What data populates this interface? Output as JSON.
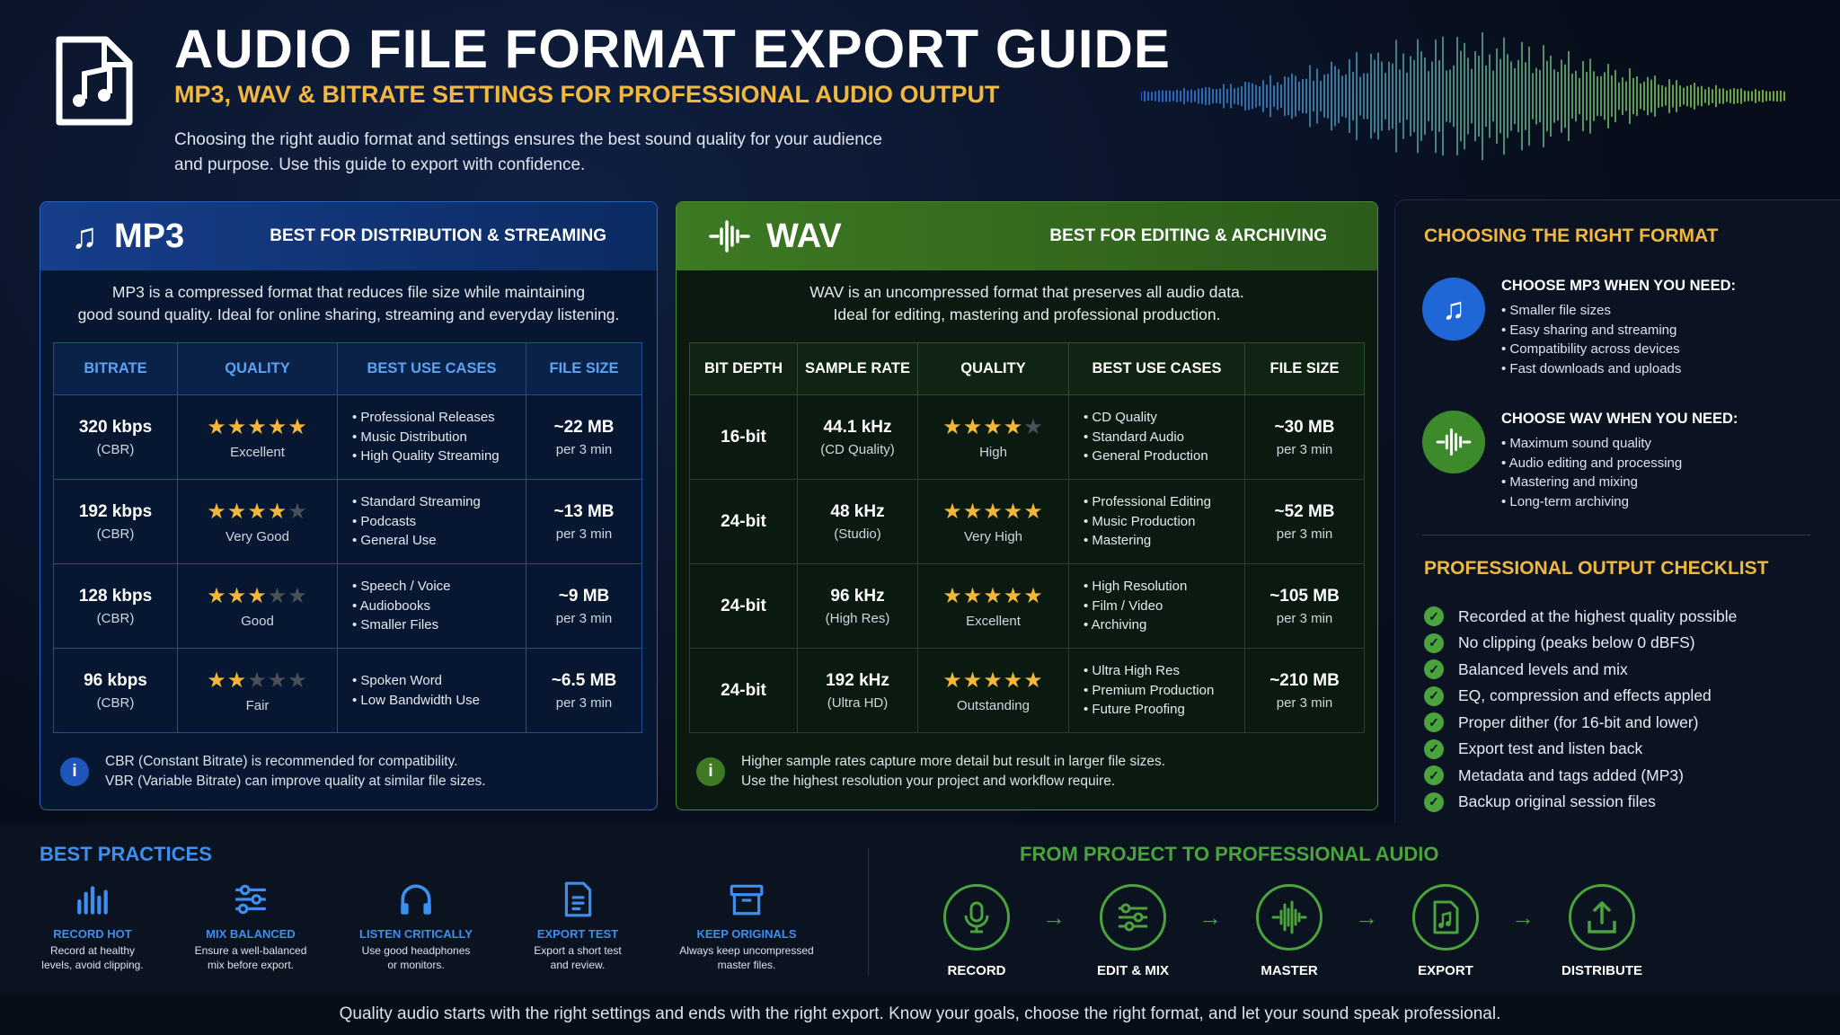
{
  "header": {
    "title": "AUDIO FILE FORMAT EXPORT GUIDE",
    "subtitle": "MP3, WAV & BITRATE SETTINGS FOR PROFESSIONAL AUDIO OUTPUT",
    "intro_line1": "Choosing the right audio format and settings ensures the best sound quality for your audience",
    "intro_line2": "and purpose. Use this guide to export with confidence."
  },
  "mp3": {
    "name": "MP3",
    "tag": "BEST FOR DISTRIBUTION & STREAMING",
    "desc_line1": "MP3 is a compressed format that reduces file size while maintaining",
    "desc_line2": "good sound quality. Ideal for online sharing, streaming and everyday listening.",
    "columns": [
      "BITRATE",
      "QUALITY",
      "BEST USE CASES",
      "FILE SIZE"
    ],
    "rows": [
      {
        "bitrate": "320 kbps",
        "mode": "(CBR)",
        "stars": 5,
        "quality": "Excellent",
        "uses": [
          "Professional Releases",
          "Music Distribution",
          "High Quality Streaming"
        ],
        "size": "~22 MB",
        "per": "per 3 min"
      },
      {
        "bitrate": "192 kbps",
        "mode": "(CBR)",
        "stars": 4,
        "quality": "Very Good",
        "uses": [
          "Standard Streaming",
          "Podcasts",
          "General Use"
        ],
        "size": "~13 MB",
        "per": "per 3 min"
      },
      {
        "bitrate": "128 kbps",
        "mode": "(CBR)",
        "stars": 3,
        "quality": "Good",
        "uses": [
          "Speech / Voice",
          "Audiobooks",
          "Smaller Files"
        ],
        "size": "~9 MB",
        "per": "per 3 min"
      },
      {
        "bitrate": "96 kbps",
        "mode": "(CBR)",
        "stars": 2,
        "quality": "Fair",
        "uses": [
          "Spoken Word",
          "Low Bandwidth Use"
        ],
        "size": "~6.5 MB",
        "per": "per 3 min"
      }
    ],
    "note_line1": "CBR (Constant Bitrate) is recommended for compatibility.",
    "note_line2": "VBR (Variable Bitrate) can improve quality at similar file sizes."
  },
  "wav": {
    "name": "WAV",
    "tag": "BEST FOR EDITING & ARCHIVING",
    "desc_line1": "WAV is an uncompressed format that preserves all audio data.",
    "desc_line2": "Ideal for editing, mastering and professional production.",
    "columns": [
      "BIT DEPTH",
      "SAMPLE RATE",
      "QUALITY",
      "BEST USE CASES",
      "FILE SIZE"
    ],
    "rows": [
      {
        "depth": "16-bit",
        "rate": "44.1 kHz",
        "rate_note": "(CD Quality)",
        "stars": 4,
        "quality": "High",
        "uses": [
          "CD Quality",
          "Standard Audio",
          "General Production"
        ],
        "size": "~30 MB",
        "per": "per 3 min"
      },
      {
        "depth": "24-bit",
        "rate": "48 kHz",
        "rate_note": "(Studio)",
        "stars": 5,
        "quality": "Very High",
        "uses": [
          "Professional Editing",
          "Music Production",
          "Mastering"
        ],
        "size": "~52 MB",
        "per": "per 3 min"
      },
      {
        "depth": "24-bit",
        "rate": "96 kHz",
        "rate_note": "(High Res)",
        "stars": 5,
        "quality": "Excellent",
        "uses": [
          "High Resolution",
          "Film / Video",
          "Archiving"
        ],
        "size": "~105 MB",
        "per": "per 3 min"
      },
      {
        "depth": "24-bit",
        "rate": "192 kHz",
        "rate_note": "(Ultra HD)",
        "stars": 5,
        "quality": "Outstanding",
        "uses": [
          "Ultra High Res",
          "Premium Production",
          "Future Proofing"
        ],
        "size": "~210 MB",
        "per": "per 3 min"
      }
    ],
    "note_line1": "Higher sample rates capture more detail but result in larger file sizes.",
    "note_line2": "Use the highest resolution your project and workflow require."
  },
  "choosing": {
    "title": "CHOOSING THE RIGHT FORMAT",
    "mp3_title": "CHOOSE MP3 WHEN YOU NEED:",
    "mp3_items": [
      "Smaller file sizes",
      "Easy sharing and streaming",
      "Compatibility across devices",
      "Fast downloads and uploads"
    ],
    "wav_title": "CHOOSE WAV WHEN YOU NEED:",
    "wav_items": [
      "Maximum sound quality",
      "Audio editing and processing",
      "Mastering and mixing",
      "Long-term archiving"
    ]
  },
  "checklist": {
    "title": "PROFESSIONAL OUTPUT CHECKLIST",
    "items": [
      "Recorded at the highest quality possible",
      "No clipping (peaks below 0 dBFS)",
      "Balanced levels and mix",
      "EQ, compression and effects appled",
      "Proper dither (for 16-bit and lower)",
      "Export test and listen back",
      "Metadata and tags added (MP3)",
      "Backup original session files"
    ]
  },
  "best_practices": {
    "title": "BEST PRACTICES",
    "items": [
      {
        "icon": "bars-icon",
        "title": "RECORD HOT",
        "line1": "Record at healthy",
        "line2": "levels, avoid clipping."
      },
      {
        "icon": "sliders-icon",
        "title": "MIX BALANCED",
        "line1": "Ensure a well-balanced",
        "line2": "mix before export."
      },
      {
        "icon": "headphones-icon",
        "title": "LISTEN CRITICALLY",
        "line1": "Use good headphones",
        "line2": "or monitors."
      },
      {
        "icon": "document-icon",
        "title": "EXPORT TEST",
        "line1": "Export a short test",
        "line2": "and review."
      },
      {
        "icon": "archive-icon",
        "title": "KEEP ORIGINALS",
        "line1": "Always keep uncompressed",
        "line2": "master files."
      }
    ]
  },
  "flow": {
    "title": "FROM PROJECT TO PROFESSIONAL AUDIO",
    "steps": [
      "RECORD",
      "EDIT & MIX",
      "MASTER",
      "EXPORT",
      "DISTRIBUTE"
    ]
  },
  "footer": "Quality audio starts with the right settings and ends with the right export. Know your goals, choose the right format, and let your sound speak professional.",
  "colors": {
    "accent_gold": "#f0b840",
    "mp3_blue": "#2a62c0",
    "wav_green": "#4aa33c",
    "star_on": "#f2b63a"
  }
}
